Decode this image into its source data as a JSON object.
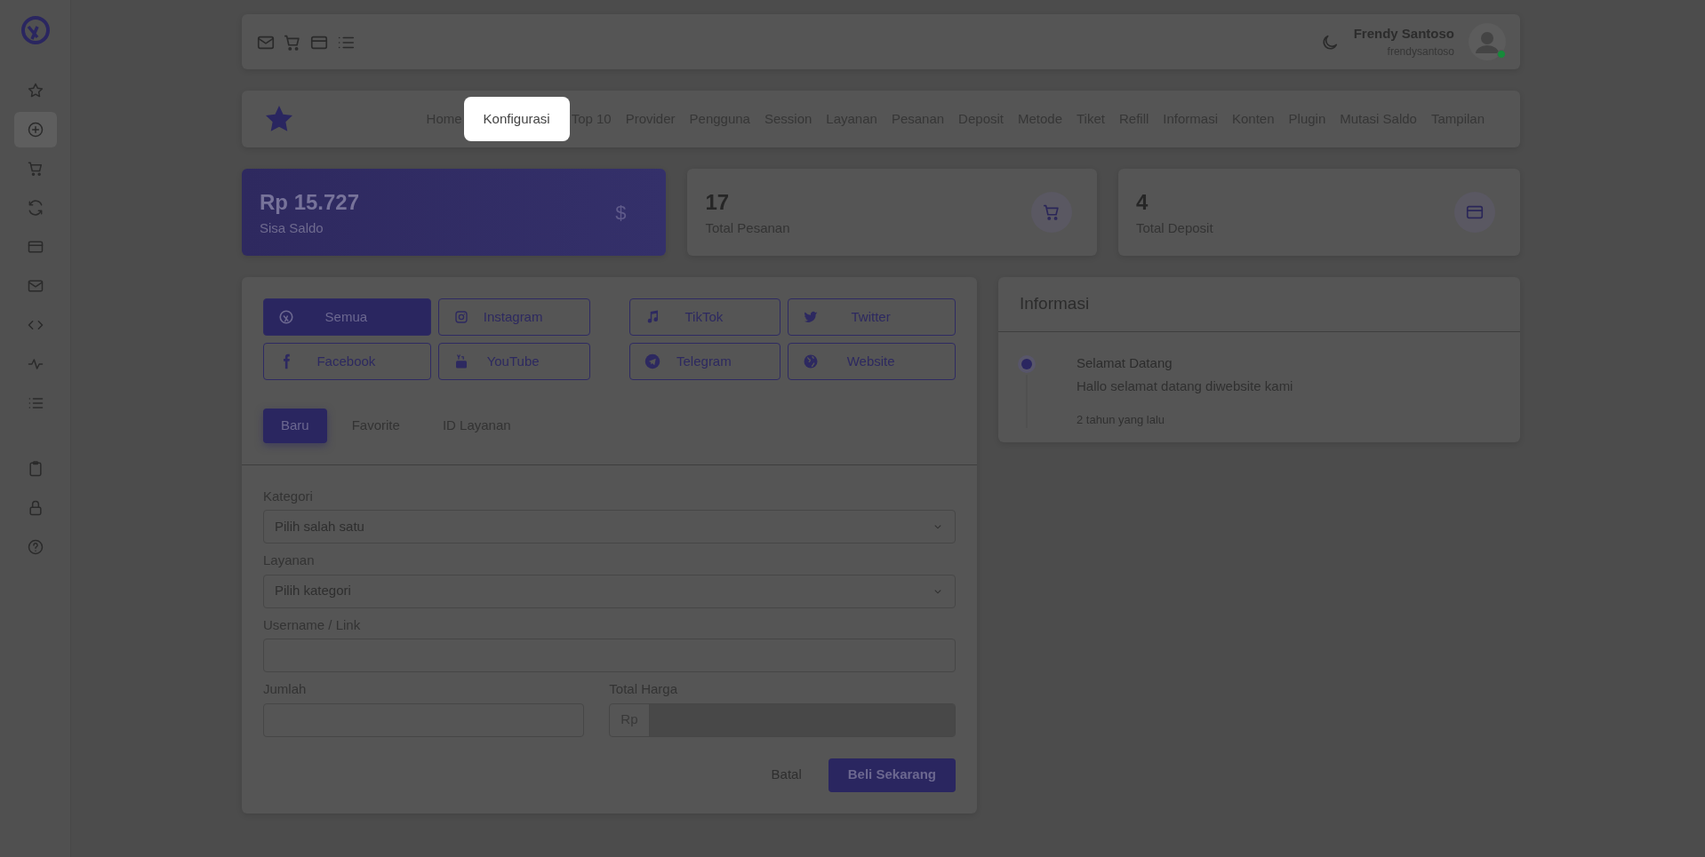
{
  "sidebar": {
    "groups": [
      {
        "items": [
          {
            "selected": false
          },
          {
            "selected": true
          },
          {
            "selected": false
          },
          {
            "selected": false
          },
          {
            "selected": false
          },
          {
            "selected": false
          },
          {
            "selected": false
          },
          {
            "selected": false
          },
          {
            "selected": false
          }
        ]
      },
      {
        "items": [
          {
            "selected": false
          },
          {
            "selected": false
          },
          {
            "selected": false
          }
        ]
      }
    ]
  },
  "topbar": {
    "user": {
      "name": "Frendy Santoso",
      "username": "frendysantoso",
      "online": true
    }
  },
  "nav": {
    "items": [
      {
        "label": "Home",
        "spotlight": false
      },
      {
        "label": "Konfigurasi",
        "spotlight": true
      },
      {
        "label": "Top 10",
        "spotlight": false
      },
      {
        "label": "Provider",
        "spotlight": false
      },
      {
        "label": "Pengguna",
        "spotlight": false
      },
      {
        "label": "Session",
        "spotlight": false
      },
      {
        "label": "Layanan",
        "spotlight": false
      },
      {
        "label": "Pesanan",
        "spotlight": false
      },
      {
        "label": "Deposit",
        "spotlight": false
      },
      {
        "label": "Metode",
        "spotlight": false
      },
      {
        "label": "Tiket",
        "spotlight": false
      },
      {
        "label": "Refill",
        "spotlight": false
      },
      {
        "label": "Informasi",
        "spotlight": false
      },
      {
        "label": "Konten",
        "spotlight": false
      },
      {
        "label": "Plugin",
        "spotlight": false
      },
      {
        "label": "Mutasi Saldo",
        "spotlight": false
      },
      {
        "label": "Tampilan",
        "spotlight": false
      }
    ]
  },
  "stats": [
    {
      "value": "Rp 15.727",
      "label": "Sisa Saldo",
      "kind": "primary",
      "symbol": "$"
    },
    {
      "value": "17",
      "label": "Total Pesanan",
      "kind": "plain"
    },
    {
      "value": "4",
      "label": "Total Deposit",
      "kind": "plain"
    }
  ],
  "order": {
    "platforms": [
      {
        "label": "Semua",
        "selected": true
      },
      {
        "label": "Instagram",
        "selected": false
      },
      {
        "label": "TikTok",
        "selected": false
      },
      {
        "label": "Twitter",
        "selected": false
      },
      {
        "label": "Facebook",
        "selected": false
      },
      {
        "label": "YouTube",
        "selected": false
      },
      {
        "label": "Telegram",
        "selected": false
      },
      {
        "label": "Website",
        "selected": false
      }
    ],
    "tabs": [
      {
        "label": "Baru",
        "selected": true
      },
      {
        "label": "Favorite",
        "selected": false
      },
      {
        "label": "ID Layanan",
        "selected": false
      }
    ],
    "kategori": {
      "label": "Kategori",
      "value": "Pilih salah satu"
    },
    "layanan": {
      "label": "Layanan",
      "value": "Pilih kategori"
    },
    "target": {
      "label": "Username / Link"
    },
    "jumlah": {
      "label": "Jumlah"
    },
    "total": {
      "label": "Total Harga",
      "prefix": "Rp",
      "disabled": true
    },
    "cancel": "Batal",
    "submit": "Beli Sekarang"
  },
  "info": {
    "title": "Informasi",
    "items": [
      {
        "title": "Selamat Datang",
        "body": "Hallo selamat datang diwebsite kami",
        "time": "2 tahun yang lalu"
      }
    ]
  }
}
